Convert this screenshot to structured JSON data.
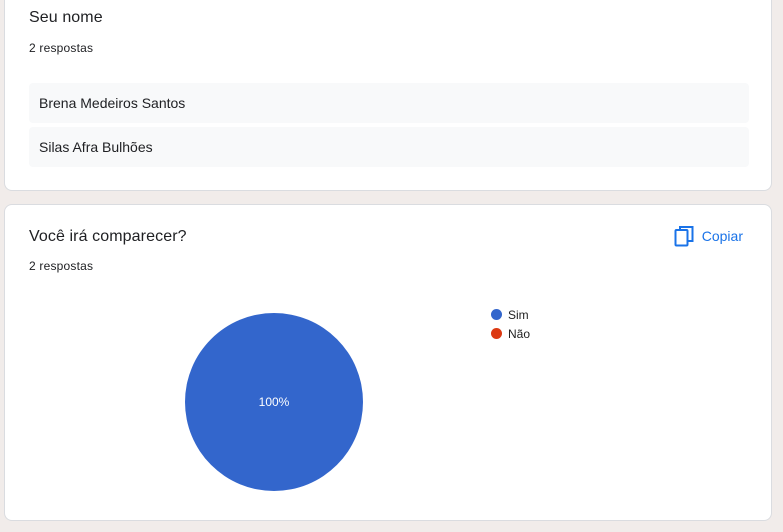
{
  "question1": {
    "title": "Seu nome",
    "count": "2 respostas",
    "responses": [
      "Brena Medeiros Santos",
      "Silas Afra Bulhões"
    ]
  },
  "question2": {
    "title": "Você irá comparecer?",
    "count": "2 respostas",
    "copy_label": "Copiar",
    "copy_icon": "copy-icon"
  },
  "chart_data": {
    "type": "pie",
    "categories": [
      "Sim",
      "Não"
    ],
    "values": [
      2,
      0
    ],
    "slice_labels": [
      "100%"
    ],
    "colors": [
      "#3366cc",
      "#dc3912"
    ],
    "legend_position": "right"
  }
}
